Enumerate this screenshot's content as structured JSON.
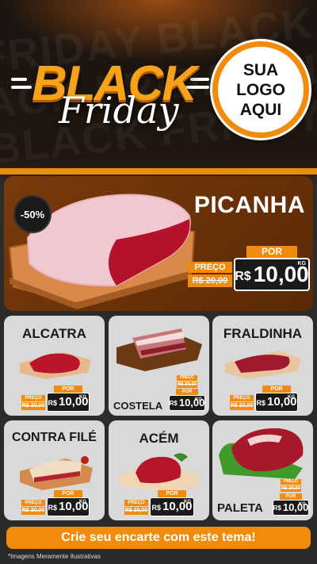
{
  "header": {
    "watermark_lines": [
      "FRIDAY BLACK FRIDAY",
      "ACK FRIDAY BLACK",
      "BLACK FRIDAY BLACK"
    ],
    "title_black": "BLACK",
    "title_friday": "Friday",
    "logo_placeholder": [
      "SUA",
      "LOGO",
      "AQUI"
    ]
  },
  "hero": {
    "discount_badge": "-50%",
    "product": "PICANHA",
    "old_label": "PREÇO",
    "old_price": "R$ 20,00",
    "new_label": "POR",
    "currency": "R$",
    "new_price": "10,00",
    "unit": "KG"
  },
  "products": [
    {
      "name": "ALCATRA",
      "old_label": "PREÇO",
      "old_price": "R$ 20,00",
      "new_label": "POR",
      "currency": "R$",
      "new_price": "10,00",
      "unit": "KG"
    },
    {
      "name": "COSTELA",
      "old_label": "PREÇO",
      "old_price": "R$ 20,00",
      "new_label": "POR",
      "currency": "R$",
      "new_price": "10,00",
      "unit": "KG"
    },
    {
      "name": "FRALDINHA",
      "old_label": "PREÇO",
      "old_price": "R$ 20,00",
      "new_label": "POR",
      "currency": "R$",
      "new_price": "10,00",
      "unit": "KG"
    },
    {
      "name": "CONTRA FILÉ",
      "old_label": "PREÇO",
      "old_price": "R$ 20,00",
      "new_label": "POR",
      "currency": "R$",
      "new_price": "10,00",
      "unit": "KG"
    },
    {
      "name": "ACÉM",
      "old_label": "PREÇO",
      "old_price": "R$ 20,00",
      "new_label": "POR",
      "currency": "R$",
      "new_price": "10,00",
      "unit": "KG"
    },
    {
      "name": "PALETA",
      "old_label": "PREÇO",
      "old_price": "R$ 20,00",
      "new_label": "POR",
      "currency": "R$",
      "new_price": "10,00",
      "unit": "KG"
    }
  ],
  "footer": {
    "cta": "Crie seu encarte com este tema!",
    "disclaimer": "*Imagens Meramente Ilustrativas"
  },
  "colors": {
    "accent": "#f28a0c",
    "dark": "#1a1a1a",
    "card": "#d9d9d9",
    "hero": "#6b3209"
  }
}
